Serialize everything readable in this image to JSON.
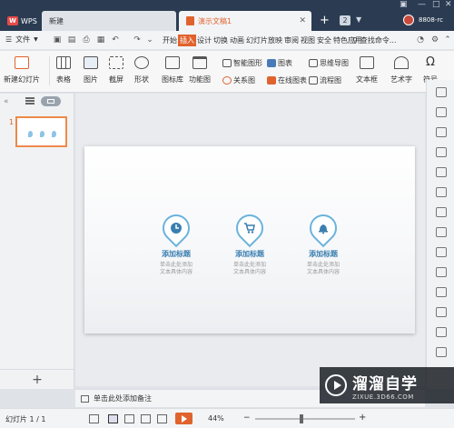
{
  "titlebar": {
    "tabs": [
      {
        "label": "WPS",
        "logo": "W"
      },
      {
        "label": "新建"
      },
      {
        "label": "演示文稿1"
      }
    ],
    "plus_icon": "+",
    "window_count": "2",
    "username": "8808-rc"
  },
  "menubar": {
    "file_label": "文件",
    "tabs": [
      "开始",
      "插入",
      "设计",
      "切换",
      "动画",
      "幻灯片放映",
      "审阅",
      "视图",
      "安全",
      "特色应用"
    ],
    "active_tab": "插入",
    "search_label": "查找命令..."
  },
  "ribbon": {
    "new_slide": "新建幻灯片",
    "table": "表格",
    "picture": "图片",
    "screenshot": "截屏",
    "shape": "形状",
    "icon_library": "图标库",
    "function_chart": "功能图",
    "smart_graphic": "智能图形",
    "chart": "图表",
    "relation_chart": "关系图",
    "online_chart": "在线图表",
    "mind_map": "思维导图",
    "flow_chart": "流程图",
    "text_box": "文本框",
    "art_text": "艺术字",
    "symbol": "符号"
  },
  "left_panel": {
    "slide_number": "1",
    "add_label": "+"
  },
  "slide": {
    "features": [
      {
        "icon": "clock-icon",
        "title": "添加标题",
        "desc_line1": "单击此处添加",
        "desc_line2": "文本具体内容"
      },
      {
        "icon": "cart-icon",
        "title": "添加标题",
        "desc_line1": "单击此处添加",
        "desc_line2": "文本具体内容"
      },
      {
        "icon": "bell-icon",
        "title": "添加标题",
        "desc_line1": "单击此处添加",
        "desc_line2": "文本具体内容"
      }
    ]
  },
  "notes": {
    "placeholder": "单击此处添加备注"
  },
  "statusbar": {
    "slide_counter": "幻灯片 1 / 1",
    "zoom": "44%"
  },
  "watermark": {
    "title": "溜溜自学",
    "subtitle": "ZIXUE.3D66.COM"
  },
  "colors": {
    "accent": "#e0632e",
    "titlebar": "#2b3c52",
    "slide_icon": "#6ab3dc",
    "feature_title": "#3a7fb0"
  }
}
